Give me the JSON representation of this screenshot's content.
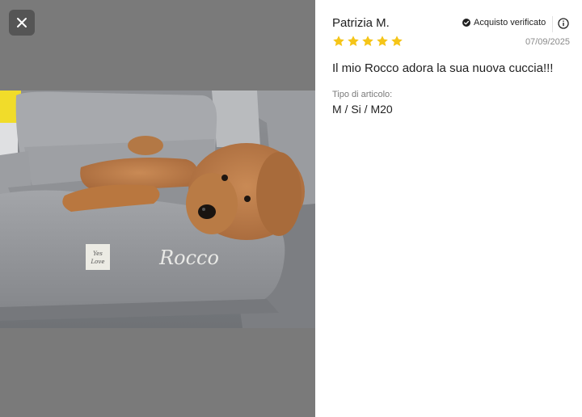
{
  "media": {
    "close_icon": "close-icon",
    "photo_embroidery": "Rocco",
    "photo_tag_text": "Yes Love"
  },
  "review": {
    "reviewer": "Patrizia M.",
    "verified_label": "Acquisto verificato",
    "verified_icon": "check-circle-icon",
    "info_icon": "info-icon",
    "rating": 5,
    "rating_max": 5,
    "date": "07/09/2025",
    "text": "Il mio Rocco adora la sua nuova cuccia!!!",
    "attribute_label": "Tipo di articolo:",
    "attribute_value": "M / Si / M20"
  },
  "colors": {
    "star": "#f5c518",
    "overlay": "#7a7a7a",
    "close_button_bg": "#555555"
  }
}
